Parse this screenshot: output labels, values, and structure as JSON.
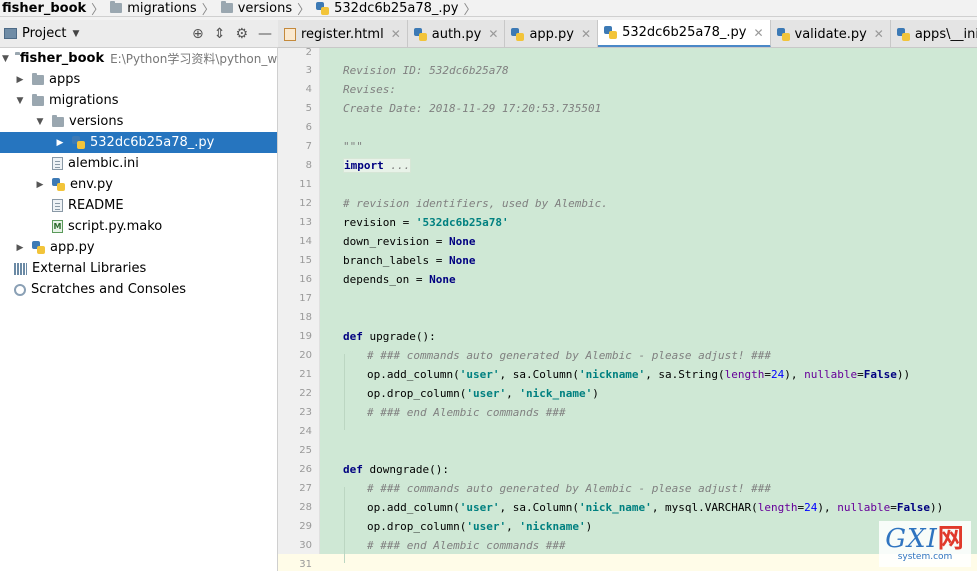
{
  "breadcrumb": [
    {
      "label": "fisher_book",
      "icon": "folder-icon"
    },
    {
      "label": "migrations",
      "icon": "folder-icon"
    },
    {
      "label": "versions",
      "icon": "folder-icon"
    },
    {
      "label": "532dc6b25a78_.py",
      "icon": "python-file-icon"
    }
  ],
  "project_panel": {
    "title": "Project",
    "tools": [
      "target-icon",
      "collapse-icon",
      "gear-icon",
      "minimize-icon"
    ]
  },
  "tree": {
    "root": {
      "name": "fisher_book",
      "path": "E:\\Python学习资料\\python_wo"
    },
    "apps": "apps",
    "migrations": "migrations",
    "versions": "versions",
    "selected_file": "532dc6b25a78_.py",
    "alembic": "alembic.ini",
    "env": "env.py",
    "readme": "README",
    "script": "script.py.mako",
    "app": "app.py",
    "ext_libs": "External Libraries",
    "scratches": "Scratches and Consoles"
  },
  "tabs": [
    {
      "label": "register.html",
      "icon": "html-file-icon"
    },
    {
      "label": "auth.py",
      "icon": "python-file-icon"
    },
    {
      "label": "app.py",
      "icon": "python-file-icon"
    },
    {
      "label": "532dc6b25a78_.py",
      "icon": "python-file-icon",
      "active": true
    },
    {
      "label": "validate.py",
      "icon": "python-file-icon"
    },
    {
      "label": "apps\\__init__.py",
      "icon": "python-file-icon"
    }
  ],
  "code": {
    "l2": "2",
    "l3": "3",
    "t3": "Revision ID: 532dc6b25a78",
    "l4": "4",
    "t4": "Revises:",
    "l5": "5",
    "t5": "Create Date: 2018-11-29 17:20:53.735501",
    "l6": "6",
    "l7": "7",
    "t7": "\"\"\"",
    "l8": "8",
    "t8_kw": "import",
    "t8_fold": " ...",
    "l11": "11",
    "l12": "12",
    "t12": "# revision identifiers, used by Alembic.",
    "l13": "13",
    "t13a": "revision = ",
    "t13b": "'532dc6b25a78'",
    "l14": "14",
    "t14a": "down_revision = ",
    "t14b": "None",
    "l15": "15",
    "t15a": "branch_labels = ",
    "t15b": "None",
    "l16": "16",
    "t16a": "depends_on = ",
    "t16b": "None",
    "l17": "17",
    "l18": "18",
    "l19": "19",
    "t19a": "def",
    "t19b": " upgrade():",
    "l20": "20",
    "t20": "# ### commands auto generated by Alembic - please adjust! ###",
    "l21": "21",
    "t21a": "op.add_column(",
    "t21b": "'user'",
    "t21c": ", sa.Column(",
    "t21d": "'nickname'",
    "t21e": ", sa.String(",
    "t21f": "length",
    "t21g": "=",
    "t21h": "24",
    "t21i": "), ",
    "t21j": "nullable",
    "t21k": "=",
    "t21l": "False",
    "t21m": "))",
    "l22": "22",
    "t22a": "op.drop_column(",
    "t22b": "'user'",
    "t22c": ", ",
    "t22d": "'nick_name'",
    "t22e": ")",
    "l23": "23",
    "t23": "# ### end Alembic commands ###",
    "l24": "24",
    "l25": "25",
    "l26": "26",
    "t26a": "def",
    "t26b": " downgrade():",
    "l27": "27",
    "t27": "# ### commands auto generated by Alembic - please adjust! ###",
    "l28": "28",
    "t28a": "op.add_column(",
    "t28b": "'user'",
    "t28c": ", sa.Column(",
    "t28d": "'nick_name'",
    "t28e": ", mysql.VARCHAR(",
    "t28f": "length",
    "t28g": "=",
    "t28h": "24",
    "t28i": "), ",
    "t28j": "nullable",
    "t28k": "=",
    "t28l": "False",
    "t28m": "))",
    "l29": "29",
    "t29a": "op.drop_column(",
    "t29b": "'user'",
    "t29c": ", ",
    "t29d": "'nickname'",
    "t29e": ")",
    "l30": "30",
    "t30": "# ### end Alembic commands ###",
    "l31": "31"
  },
  "watermark": {
    "big": "GXI",
    "accent": "网",
    "small": "system.com"
  }
}
